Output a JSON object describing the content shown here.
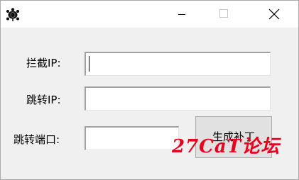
{
  "window": {
    "title": "",
    "controls": {
      "minimize_icon": "minimize-icon",
      "maximize_icon": "maximize-icon",
      "close_icon": "close-icon"
    },
    "app_icon": "turtle-icon"
  },
  "form": {
    "intercept_ip": {
      "label": "拦截IP:",
      "value": ""
    },
    "jump_ip": {
      "label": "跳转IP:",
      "value": ""
    },
    "jump_port": {
      "label": "跳转端口:",
      "value": ""
    },
    "generate_button": {
      "label": "生成补丁"
    }
  },
  "watermark": {
    "text": "27CaT论坛"
  },
  "colors": {
    "window_bg": "#f0f0f0",
    "titlebar_bg": "#ffffff",
    "button_bg": "#e1e1e1",
    "watermark": "#e8001c"
  }
}
